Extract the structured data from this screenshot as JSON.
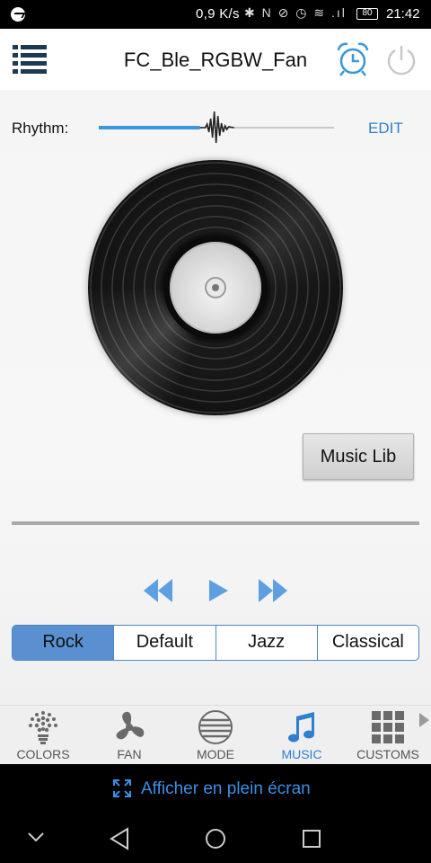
{
  "status_bar": {
    "network_speed": "0,9 K/s",
    "system_icons": "✱ N ⊘ ◷ ≋ .ıl",
    "battery": "80",
    "time": "21:42",
    "notification_icon": "messenger-icon"
  },
  "header": {
    "title": "FC_Ble_RGBW_Fan",
    "menu_icon": "list-menu-icon",
    "alarm_icon": "alarm-clock-icon",
    "power_icon": "power-icon"
  },
  "rhythm": {
    "label": "Rhythm:",
    "edit": "EDIT",
    "level": 0.43
  },
  "music_lib": {
    "label": "Music Lib"
  },
  "playback": {
    "progress": 0
  },
  "genres": [
    {
      "label": "Rock",
      "active": true
    },
    {
      "label": "Default",
      "active": false
    },
    {
      "label": "Jazz",
      "active": false
    },
    {
      "label": "Classical",
      "active": false
    }
  ],
  "tabs": [
    {
      "label": "COLORS",
      "icon": "bulb-icon",
      "active": false
    },
    {
      "label": "FAN",
      "icon": "fan-icon",
      "active": false
    },
    {
      "label": "MODE",
      "icon": "mode-icon",
      "active": false
    },
    {
      "label": "MUSIC",
      "icon": "music-note-icon",
      "active": true
    },
    {
      "label": "CUSTOMS",
      "icon": "grid-icon",
      "active": false
    }
  ],
  "fullscreen_prompt": {
    "label": "Afficher en plein écran"
  },
  "colors": {
    "accent": "#2e7fd0",
    "active_genre": "#5a90d0",
    "slider_fill": "#3a98d8",
    "transport": "#5d9fe0"
  }
}
